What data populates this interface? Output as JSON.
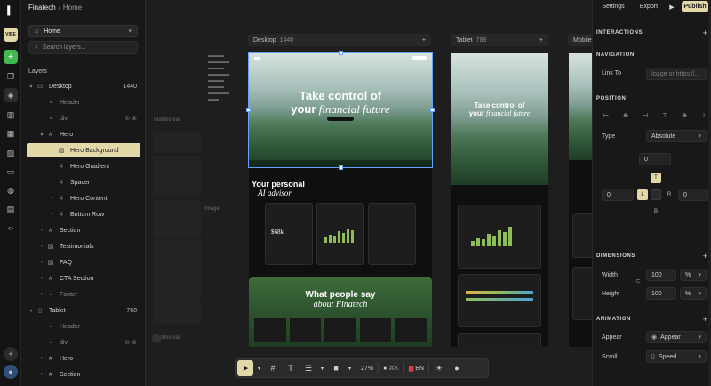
{
  "app": {
    "badge": "VIBE"
  },
  "breadcrumb": {
    "project": "Finatech",
    "page": "Home"
  },
  "left": {
    "page_select": "Home",
    "search_placeholder": "Search layers...",
    "layers_heading": "Layers",
    "layers": [
      {
        "label": "Desktop",
        "meta": "1440",
        "indent": 0,
        "icon": "monitor-icon",
        "chev": "▾"
      },
      {
        "label": "Header",
        "indent": 1,
        "icon": "lock-icon",
        "dim": true
      },
      {
        "label": "div",
        "indent": 1,
        "icon": "lock-icon",
        "dim": true,
        "flags": true
      },
      {
        "label": "Hero",
        "indent": 1,
        "icon": "frame-icon",
        "chev": "▾"
      },
      {
        "label": "Hero Background",
        "indent": 2,
        "icon": "image-icon",
        "selected": true
      },
      {
        "label": "Hero Gradient",
        "indent": 2,
        "icon": "frame-icon"
      },
      {
        "label": "Spacer",
        "indent": 2,
        "icon": "frame-icon"
      },
      {
        "label": "Hero Content",
        "indent": 2,
        "icon": "frame-icon",
        "chev": "›"
      },
      {
        "label": "Bottom Row",
        "indent": 2,
        "icon": "frame-icon",
        "chev": "›"
      },
      {
        "label": "Section",
        "indent": 1,
        "icon": "frame-icon",
        "chev": "›"
      },
      {
        "label": "Testimonials",
        "indent": 1,
        "icon": "image-icon",
        "chev": "›"
      },
      {
        "label": "FAQ",
        "indent": 1,
        "icon": "image-icon",
        "chev": "›"
      },
      {
        "label": "CTA Section",
        "indent": 1,
        "icon": "frame-icon",
        "chev": "›"
      },
      {
        "label": "Footer",
        "indent": 1,
        "icon": "lock-icon",
        "dim": true,
        "chev": "›"
      },
      {
        "label": "Tablet",
        "meta": "768",
        "indent": 0,
        "icon": "tablet-icon",
        "chev": "▾"
      },
      {
        "label": "Header",
        "indent": 1,
        "icon": "lock-icon",
        "dim": true
      },
      {
        "label": "div",
        "indent": 1,
        "icon": "lock-icon",
        "dim": true,
        "flags": true
      },
      {
        "label": "Hero",
        "indent": 1,
        "icon": "frame-icon",
        "chev": "›"
      },
      {
        "label": "Section",
        "indent": 1,
        "icon": "frame-icon",
        "chev": "›"
      }
    ]
  },
  "canvas": {
    "frames": [
      {
        "name": "Desktop",
        "width": "1440"
      },
      {
        "name": "Tablet",
        "width": "768"
      },
      {
        "name": "Mobile"
      }
    ],
    "ghost_labels": [
      "Testimonial",
      "Testimonial",
      "Image"
    ],
    "hero_title_1": "Take control of",
    "hero_title_2": "your",
    "hero_title_em": "financial future",
    "tablet_title_1": "Take control of",
    "tablet_title_2": "your",
    "tablet_title_em": "financial future",
    "advisor_1": "Your personal",
    "advisor_2": "AI advisor",
    "people_1": "What people say",
    "people_2": "about Finatech",
    "card_amount": "$68k"
  },
  "toolbar": {
    "zoom": "27%",
    "language": "EN",
    "shortcut": "⌘K"
  },
  "right": {
    "tabs": {
      "settings": "Settings",
      "export": "Export",
      "publish": "Publish"
    },
    "interactions": "INTERACTIONS",
    "navigation": "NAVIGATION",
    "link_to_label": "Link To",
    "link_placeholder": "/page or https://...",
    "position": "POSITION",
    "type_label": "Type",
    "type_value": "Absolute",
    "pos_top": "0",
    "pos_left": "0",
    "pos_right": "0",
    "box_t": "T",
    "box_l": "L",
    "box_r": "R",
    "box_b": "B",
    "dimensions": "DIMENSIONS",
    "width_label": "Width",
    "width_value": "100",
    "width_unit": "%",
    "height_label": "Height",
    "height_value": "100",
    "height_unit": "%",
    "animation": "ANIMATION",
    "appear_label": "Appear",
    "appear_value": "Appear",
    "scroll_label": "Scroll",
    "scroll_value": "Speed"
  },
  "colors": {
    "accent": "#e3d9a8",
    "selection": "#6aa0ff",
    "add_button": "#3fb950"
  }
}
